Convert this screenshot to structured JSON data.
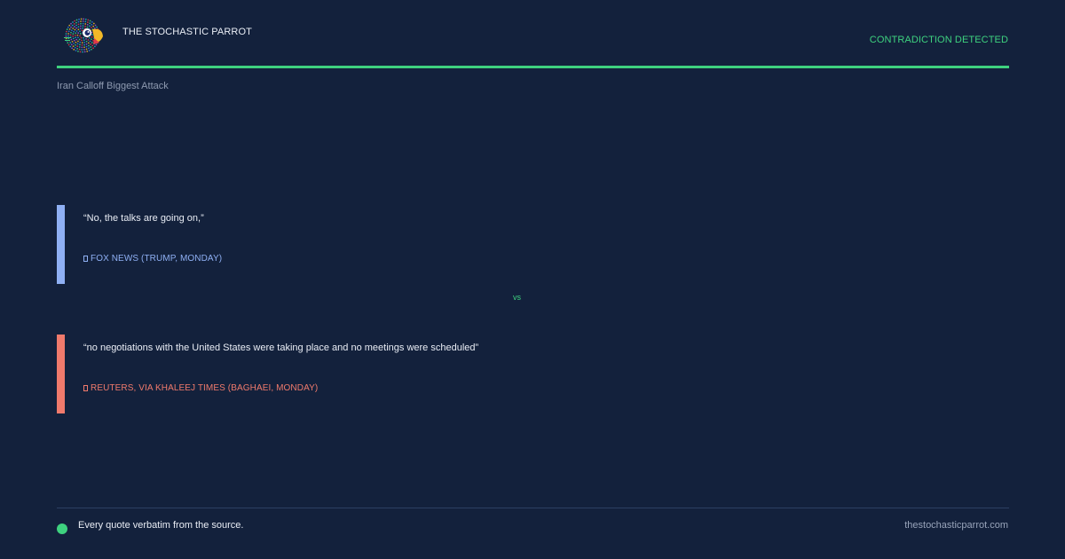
{
  "header": {
    "brand": "THE STOCHASTIC PARROT",
    "status": "CONTRADICTION DETECTED",
    "logo_icon": "parrot-logo-icon",
    "accent_color": "#3ed27f"
  },
  "topic": "Iran Calloff Biggest Attack",
  "quotes": [
    {
      "text": "“No, the talks are going on,”",
      "source": "FOX NEWS (TRUMP, MONDAY)",
      "color": "#8fb0f4"
    },
    {
      "text": "“no negotiations with the United States were taking place and no meetings were scheduled”",
      "source": "REUTERS, VIA KHALEEJ TIMES (BAGHAEI, MONDAY)",
      "color": "#f07a6c"
    }
  ],
  "vs_label": "vs",
  "footer": {
    "note": "Every quote verbatim from the source.",
    "url": "thestochasticparrot.com"
  }
}
